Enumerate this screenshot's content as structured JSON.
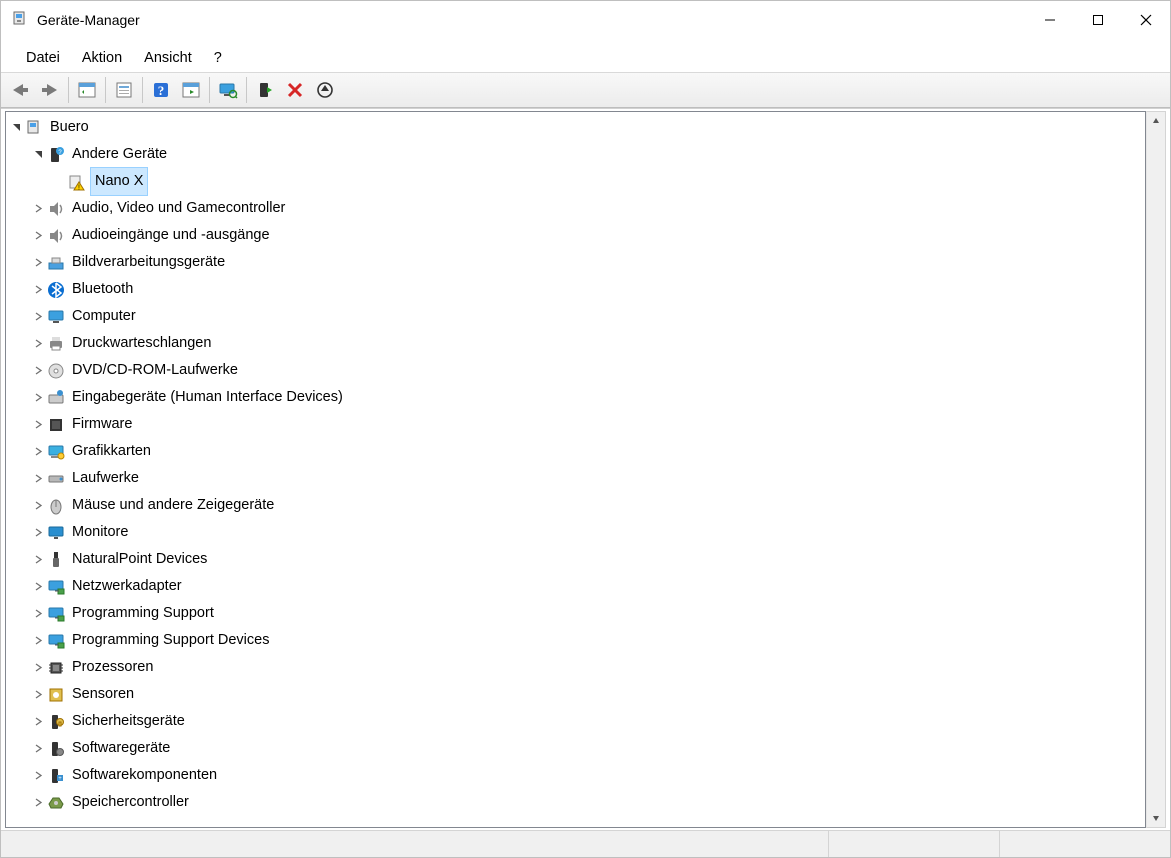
{
  "window": {
    "title": "Geräte-Manager"
  },
  "menu": {
    "file": "Datei",
    "action": "Aktion",
    "view": "Ansicht",
    "help": "?"
  },
  "toolbar_tooltips": {
    "back": "Zurück",
    "forward": "Vorwärts",
    "show_props": "Eigenschaften anzeigen",
    "properties": "Eigenschaftenblatt",
    "help": "Hilfe",
    "show_hidden": "Ausgeblendete Geräte anzeigen",
    "scan": "Nach geänderter Hardware suchen",
    "enable": "Gerät aktivieren",
    "uninstall": "Gerät deinstallieren",
    "update": "Treiber aktualisieren"
  },
  "tree": {
    "root": "Buero",
    "nodes": [
      {
        "icon": "other",
        "label": "Andere Geräte",
        "expanded": true,
        "children": [
          {
            "icon": "warning",
            "label": "Nano X",
            "selected": true
          }
        ]
      },
      {
        "icon": "audio",
        "label": "Audio, Video und Gamecontroller"
      },
      {
        "icon": "audio",
        "label": "Audioeingänge und -ausgänge"
      },
      {
        "icon": "imaging",
        "label": "Bildverarbeitungsgeräte"
      },
      {
        "icon": "bluetooth",
        "label": "Bluetooth"
      },
      {
        "icon": "computer",
        "label": "Computer"
      },
      {
        "icon": "printer",
        "label": "Druckwarteschlangen"
      },
      {
        "icon": "disc",
        "label": "DVD/CD-ROM-Laufwerke"
      },
      {
        "icon": "hid",
        "label": "Eingabegeräte (Human Interface Devices)"
      },
      {
        "icon": "firmware",
        "label": "Firmware"
      },
      {
        "icon": "display",
        "label": "Grafikkarten"
      },
      {
        "icon": "drive",
        "label": "Laufwerke"
      },
      {
        "icon": "mouse",
        "label": "Mäuse und andere Zeigegeräte"
      },
      {
        "icon": "monitor",
        "label": "Monitore"
      },
      {
        "icon": "usb",
        "label": "NaturalPoint Devices"
      },
      {
        "icon": "network",
        "label": "Netzwerkadapter"
      },
      {
        "icon": "network",
        "label": "Programming Support"
      },
      {
        "icon": "network",
        "label": "Programming Support Devices"
      },
      {
        "icon": "cpu",
        "label": "Prozessoren"
      },
      {
        "icon": "sensor",
        "label": "Sensoren"
      },
      {
        "icon": "security",
        "label": "Sicherheitsgeräte"
      },
      {
        "icon": "software",
        "label": "Softwaregeräte"
      },
      {
        "icon": "component",
        "label": "Softwarekomponenten"
      },
      {
        "icon": "storage",
        "label": "Speichercontroller"
      }
    ]
  }
}
